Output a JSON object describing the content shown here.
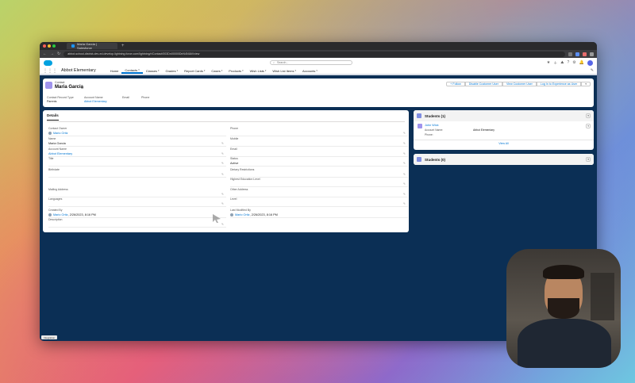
{
  "browser": {
    "tab_title": "Maria Garcia | Salesforce",
    "url": "abbot-school-district-dev-ed.develop.lightning.force.com/lightning/r/Contact/003Dn00000DnN4NIAV/view"
  },
  "header": {
    "search_placeholder": "Search...",
    "app_name": "Abbot Elementary"
  },
  "nav": {
    "items": [
      {
        "label": "Home",
        "active": false,
        "dropdown": false
      },
      {
        "label": "Contacts",
        "active": true,
        "dropdown": true
      },
      {
        "label": "Classes",
        "active": false,
        "dropdown": true
      },
      {
        "label": "Grades",
        "active": false,
        "dropdown": true
      },
      {
        "label": "Report Cards",
        "active": false,
        "dropdown": true
      },
      {
        "label": "Cases",
        "active": false,
        "dropdown": true
      },
      {
        "label": "Products",
        "active": false,
        "dropdown": true
      },
      {
        "label": "Wish Lists",
        "active": false,
        "dropdown": true
      },
      {
        "label": "Wish List Items",
        "active": false,
        "dropdown": true
      },
      {
        "label": "Accounts",
        "active": false,
        "dropdown": true
      }
    ]
  },
  "record": {
    "object_type": "Contact",
    "name": "Maria Garcia",
    "actions": [
      "+ Follow",
      "Disable Customer User",
      "View Customer User",
      "Log In to Experience as User",
      "▾"
    ],
    "highlights": [
      {
        "label": "Contact Record Type",
        "value": "Parents",
        "link": false
      },
      {
        "label": "Account Name",
        "value": "Abbot Elementary",
        "link": true
      },
      {
        "label": "Email",
        "value": "",
        "link": false
      },
      {
        "label": "Phone",
        "value": "",
        "link": false
      }
    ]
  },
  "details": {
    "tab_label": "Details",
    "left": [
      {
        "label": "Contact Owner",
        "value": "Mario Ortiz",
        "link": true,
        "avatar": true
      },
      {
        "label": "Name",
        "value": "Maria Garcia",
        "link": false
      },
      {
        "label": "Account Name",
        "value": "Abbot Elementary",
        "link": true
      },
      {
        "label": "Title",
        "value": "",
        "link": false
      },
      {
        "label": "Birthdate",
        "value": "",
        "link": false
      },
      {
        "label": "Mailing Address",
        "value": "",
        "link": false
      },
      {
        "label": "Languages",
        "value": "",
        "link": false
      },
      {
        "label": "Created By",
        "value": "Mario Ortiz",
        "extra": ", 2/26/2023, 8:16 PM",
        "link": true,
        "avatar": true
      },
      {
        "label": "Description",
        "value": "",
        "link": false
      }
    ],
    "right": [
      {
        "label": "Phone",
        "value": ""
      },
      {
        "label": "Mobile",
        "value": ""
      },
      {
        "label": "Email",
        "value": ""
      },
      {
        "label": "Status",
        "value": "Active"
      },
      {
        "label": "Dietary Restrictions",
        "value": ""
      },
      {
        "label": "Highest Education Level",
        "value": ""
      },
      {
        "label": "Other Address",
        "value": ""
      },
      {
        "label": "Level",
        "value": ""
      },
      {
        "label": "Last Modified By",
        "value": "Mario Ortiz",
        "extra": ", 2/26/2023, 8:16 PM",
        "link": true,
        "avatar": true
      }
    ]
  },
  "related": {
    "students_1": {
      "title": "Students (1)",
      "record_name": "John Wick",
      "account_label": "Account Name:",
      "account_value": "Abbot Elementary",
      "phone_label": "Phone:",
      "view_all": "View All"
    },
    "students_0": {
      "title": "Students (0)"
    }
  },
  "status_chip": "Integration",
  "colors": {
    "brand": "#0176d3",
    "window_bg": "#0b2f55",
    "contact_icon": "#a094ed"
  }
}
